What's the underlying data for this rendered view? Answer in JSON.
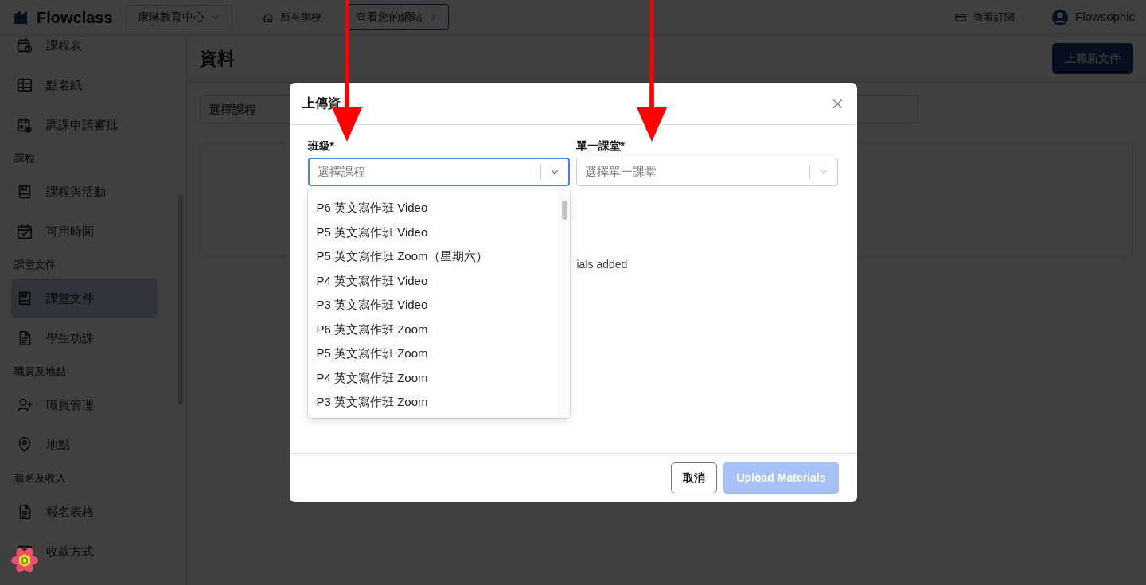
{
  "topbar": {
    "logo": "Flowclass",
    "org_select": "康琳教育中心",
    "all_schools": "所有學校",
    "view_site": "查看您的網站",
    "subscription": "查看訂閱",
    "user": "Flowsophic"
  },
  "sidebar": {
    "items": [
      {
        "kind": "item",
        "label": "課程表",
        "selected": false
      },
      {
        "kind": "item",
        "label": "點名紙",
        "selected": false
      },
      {
        "kind": "item",
        "label": "調課申請審批",
        "selected": false
      },
      {
        "kind": "section",
        "label": "課程"
      },
      {
        "kind": "item",
        "label": "課程與活動",
        "selected": false
      },
      {
        "kind": "item",
        "label": "可用時間",
        "selected": false
      },
      {
        "kind": "section",
        "label": "課堂文件"
      },
      {
        "kind": "item",
        "label": "課堂文件",
        "selected": true
      },
      {
        "kind": "item",
        "label": "學生功課",
        "selected": false
      },
      {
        "kind": "section",
        "label": "職員及地點"
      },
      {
        "kind": "item",
        "label": "職員管理",
        "selected": false
      },
      {
        "kind": "item",
        "label": "地點",
        "selected": false
      },
      {
        "kind": "section",
        "label": "報名及收入"
      },
      {
        "kind": "item",
        "label": "報名表格",
        "selected": false
      },
      {
        "kind": "item",
        "label": "收款方式",
        "selected": false
      }
    ]
  },
  "page": {
    "title": "資料",
    "upload_button": "上載新文件",
    "filter": {
      "placeholder": "選擇課程"
    },
    "empty_text": "ials added"
  },
  "modal": {
    "title": "上傳資",
    "fields": [
      {
        "label": "班級*",
        "placeholder": "選擇課程",
        "focused": true
      },
      {
        "label": "單一課堂*",
        "placeholder": "選擇單一課堂",
        "focused": false
      }
    ],
    "options": [
      "P6 英文寫作班 Video",
      "P5 英文寫作班 Video",
      "P5 英文寫作班 Zoom（星期六）",
      "P4 英文寫作班 Video",
      "P3 英文寫作班 Video",
      "P6 英文寫作班 Zoom",
      "P5 英文寫作班 Zoom",
      "P4 英文寫作班 Zoom",
      "P3 英文寫作班 Zoom"
    ],
    "buttons": [
      {
        "label": "取消",
        "kind": "secondary",
        "disabled": false
      },
      {
        "label": "Upload Materials",
        "kind": "primary",
        "disabled": true
      }
    ]
  },
  "annotations": [
    {
      "kind": "arrow"
    },
    {
      "kind": "arrow"
    }
  ]
}
